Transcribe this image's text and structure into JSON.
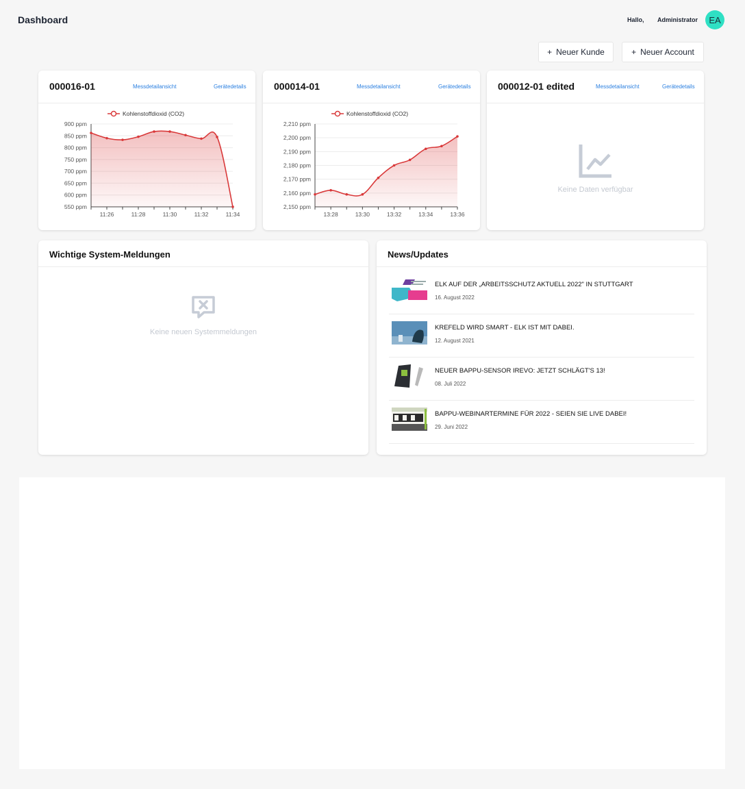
{
  "header": {
    "title": "Dashboard",
    "greeting": "Hallo,",
    "user": "Administrator",
    "avatar_initials": "EA",
    "avatar_color": "#2fe0c4"
  },
  "actions": {
    "new_customer": "Neuer Kunde",
    "new_account": "Neuer Account"
  },
  "devices": [
    {
      "title": "000016-01",
      "link_measure": "Messdetailansicht",
      "link_device": "Gerätedetails"
    },
    {
      "title": "000014-01",
      "link_measure": "Messdetailansicht",
      "link_device": "Gerätedetails"
    },
    {
      "title": "000012-01 edited",
      "link_measure": "Messdetailansicht",
      "link_device": "Gerätedetails",
      "empty_text": "Keine Daten verfügbar"
    }
  ],
  "system_messages": {
    "title": "Wichtige System-Meldungen",
    "empty_text": "Keine neuen Systemmeldungen"
  },
  "news": {
    "title": "News/Updates",
    "items": [
      {
        "title": "ELK AUF DER „ARBEITSSCHUTZ AKTUELL 2022\" IN STUTTGART",
        "date": "16. August 2022"
      },
      {
        "title": "KREFELD WIRD SMART - ELK IST MIT DABEI.",
        "date": "12. August 2021"
      },
      {
        "title": "NEUER BAPPU-SENSOR IREVO: JETZT SCHLÄGT'S 13!",
        "date": "08. Juli 2022"
      },
      {
        "title": "BAPPU-WEBINARTERMINE FÜR 2022 - SEIEN SIE LIVE DABEI!",
        "date": "29. Juni 2022"
      }
    ]
  },
  "colors": {
    "series": "#d9393a",
    "link": "#2a7fe0",
    "empty_icon": "#c6ccd6"
  },
  "chart_data": [
    {
      "type": "area",
      "legend": "Kohlenstoffdioxid (CO2)",
      "x_labels": [
        "11:26",
        "11:28",
        "11:30",
        "11:32",
        "11:34"
      ],
      "y_labels": [
        "550 ppm",
        "600 ppm",
        "650 ppm",
        "700 ppm",
        "750 ppm",
        "800 ppm",
        "850 ppm",
        "900 ppm"
      ],
      "ylim": [
        550,
        900
      ],
      "series": [
        {
          "values": [
            862,
            840,
            833,
            846,
            868,
            868,
            853,
            838,
            845,
            550
          ]
        }
      ]
    },
    {
      "type": "area",
      "legend": "Kohlenstoffdioxid (CO2)",
      "x_labels": [
        "13:28",
        "13:30",
        "13:32",
        "13:34",
        "13:36"
      ],
      "y_labels": [
        "2,150 ppm",
        "2,160 ppm",
        "2,170 ppm",
        "2,180 ppm",
        "2,190 ppm",
        "2,200 ppm",
        "2,210 ppm"
      ],
      "ylim": [
        2150,
        2210
      ],
      "series": [
        {
          "values": [
            2159,
            2162,
            2159,
            2159,
            2171,
            2180,
            2184,
            2192,
            2194,
            2201
          ]
        }
      ]
    }
  ]
}
